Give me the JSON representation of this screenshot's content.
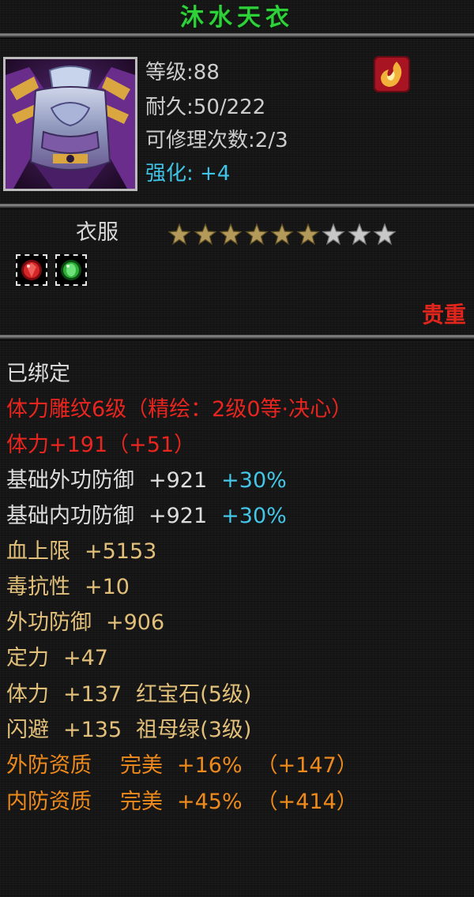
{
  "item": {
    "name": "沐水天衣",
    "level_label": "等级",
    "level_value": ":88",
    "durability_label": "耐久",
    "durability_value": ":50/222",
    "repair_label": "可修理次数",
    "repair_value": ":2/3",
    "enhance_label": "强化:",
    "enhance_value": "+4",
    "type": "衣服",
    "stars_total": 9,
    "stars_filled": 6,
    "rarity": "贵重",
    "rank_icon": "flame-emblem-icon",
    "portrait_icon": "armor-robe-icon",
    "gems": [
      {
        "icon": "ruby-gem-icon",
        "color": "#d42828"
      },
      {
        "icon": "emerald-gem-icon",
        "color": "#2fae38"
      }
    ]
  },
  "details": {
    "bound": "已绑定",
    "carving": "体力雕纹6级（精绘：2级0等·决心）",
    "carving_stat_label": "体力+191",
    "carving_stat_bonus": "（+51）",
    "base_outer_def_label": "基础外功防御",
    "base_outer_def_value": "+921",
    "base_outer_def_bonus": "+30%",
    "base_inner_def_label": "基础内功防御",
    "base_inner_def_value": "+921",
    "base_inner_def_bonus": "+30%",
    "hp_label": "血上限",
    "hp_value": "+5153",
    "poison_label": "毒抗性",
    "poison_value": "+10",
    "outer_def_label": "外功防御",
    "outer_def_value": "+906",
    "focus_label": "定力",
    "focus_value": "+47",
    "vit_label": "体力",
    "vit_value": "+137",
    "vit_gem": "红宝石(5级)",
    "dodge_label": "闪避",
    "dodge_value": "+135",
    "dodge_gem": "祖母绿(3级)",
    "outer_quality_label": "外防资质",
    "outer_quality_grade": "完美",
    "outer_quality_value": "+16%",
    "outer_quality_bonus": "（+147）",
    "inner_quality_label": "内防资质",
    "inner_quality_grade": "完美",
    "inner_quality_value": "+45%",
    "inner_quality_bonus": "（+414）"
  },
  "colors": {
    "title": "#2fd13a",
    "highlight_cyan": "#43c6e8",
    "carving_red": "#e8251f",
    "stat_gold": "#e2c07a",
    "quality_orange": "#ee8a1c",
    "star_filled": "#b49a5a",
    "star_empty": "#c8c8c8"
  }
}
